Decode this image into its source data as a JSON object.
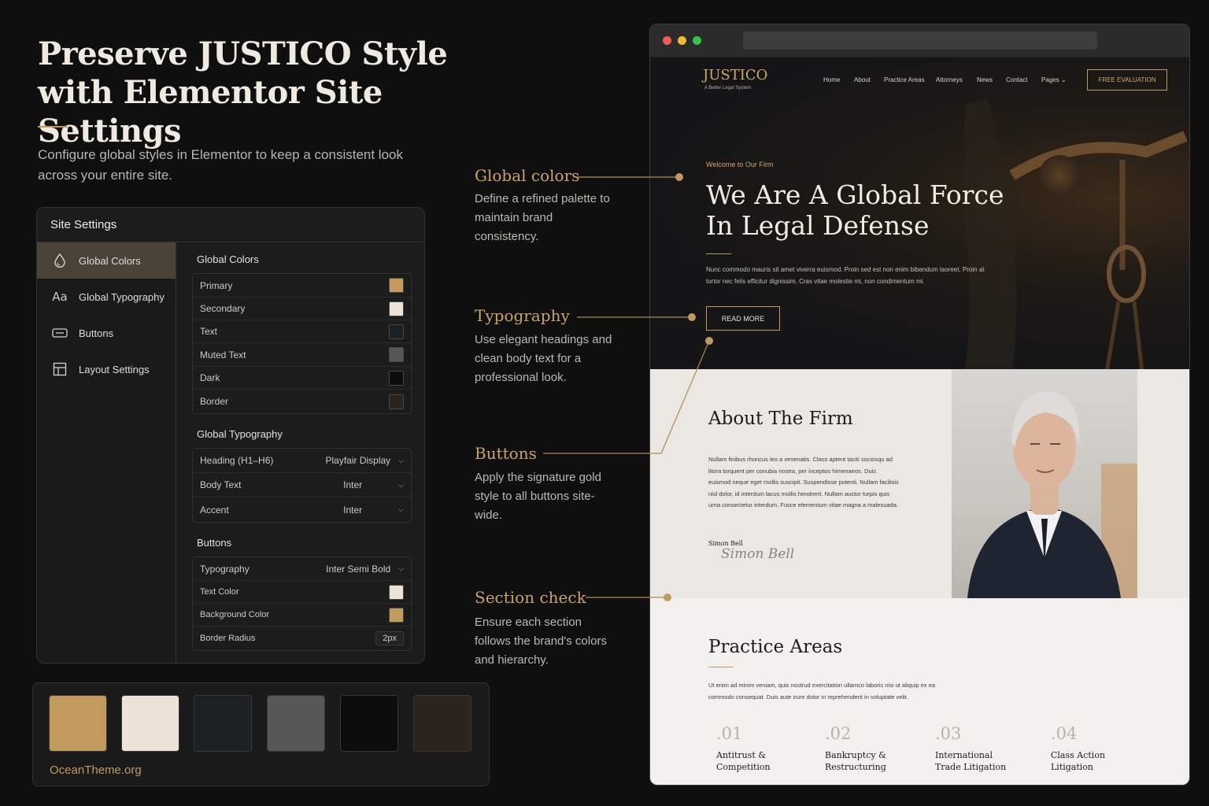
{
  "hero": {
    "title": "Preserve JUSTICO Style with Elementor Site Settings",
    "subtitle": "Configure global styles in Elementor to keep a consistent look across your entire site."
  },
  "settings": {
    "title": "Site Settings",
    "sidebar": [
      {
        "label": "Global Colors",
        "icon": "drop-icon",
        "active": true
      },
      {
        "label": "Global Typography",
        "icon": "typography-icon"
      },
      {
        "label": "Buttons",
        "icon": "button-icon"
      },
      {
        "label": "Layout Settings",
        "icon": "layout-icon"
      }
    ],
    "colors": {
      "title": "Global Colors",
      "items": [
        {
          "label": "Primary",
          "color": "#c29a5e"
        },
        {
          "label": "Secondary",
          "color": "#ede3d6"
        },
        {
          "label": "Text",
          "color": "#1b2025"
        },
        {
          "label": "Muted Text",
          "color": "#575757"
        },
        {
          "label": "Dark",
          "color": "#0c0c0c"
        },
        {
          "label": "Border",
          "color": "#2b231d"
        }
      ]
    },
    "typography": {
      "title": "Global Typography",
      "items": [
        {
          "label": "Heading (H1–H6)",
          "value": "Playfair Display"
        },
        {
          "label": "Body Text",
          "value": "Inter"
        },
        {
          "label": "Accent",
          "value": "Inter"
        }
      ]
    },
    "buttons": {
      "title": "Buttons",
      "typography_label": "Typography",
      "typography_value": "Inter Semi Bold",
      "text_color_label": "Text Color",
      "text_color": "#ede3d6",
      "bg_color_label": "Background Color",
      "bg_color": "#c29a5e",
      "radius_label": "Border Radius",
      "radius_value": "2px"
    }
  },
  "palette": {
    "colors": [
      "#c29a5e",
      "#ede3d6",
      "#1b2025",
      "#575757",
      "#0c0c0c",
      "#2b231d"
    ],
    "brand": "OceanTheme.org"
  },
  "annotations": [
    {
      "title": "Global colors",
      "text": "Define a refined palette to maintain brand consistency."
    },
    {
      "title": "Typography",
      "text": "Use elegant headings and clean body text for a professional look."
    },
    {
      "title": "Buttons",
      "text": "Apply the signature gold style to all buttons site-wide."
    },
    {
      "title": "Section check",
      "text": "Ensure each section follows the brand's colors and hierarchy."
    }
  ],
  "site": {
    "logo": "JUSTICO",
    "logo_tagline": "A Better Legal System",
    "nav": [
      "Home",
      "About",
      "Practice Areas",
      "Attorneys",
      "News",
      "Contact",
      "Pages"
    ],
    "cta": "FREE EVALUATION",
    "welcome": "Welcome to Our Firm",
    "hero_heading": "We Are A Global Force In Legal Defense",
    "hero_text": "Nunc commodo mauris sit amet viverra euismod. Proin sed est non enim bibendum laoreet. Proin at tortor nec felis efficitur dignissim. Cras vitae molestie mi, non condimentum mi.",
    "read_more": "READ MORE",
    "about_heading": "About The Firm",
    "about_text": "Nullam finibus rhoncus leo a venenatis. Class aptent taciti sociosqu ad litora torquent per conubia nostra, per inceptos himenaeos. Duis euismod neque eget mollis suscipit. Suspendisse potenti. Nullam facilisis nisl dolor, id interdum lacus mollis hendrerit. Nullam auctor turpis quis urna consectetur interdum. Fusce elementum vitae magna a malesuada.",
    "about_name": "Simon Bell",
    "about_signature": "Simon Bell",
    "practice_heading": "Practice Areas",
    "practice_text": "Ut enim ad minim veniam, quis nostrud exercitation ullamco laboris nisi ut aliquip ex ea commodo consequat. Duis aute irure dolor in reprehenderit in voluptate velit.",
    "practice_areas": [
      {
        "num": ".01",
        "name": "Antitrust & Competition"
      },
      {
        "num": ".02",
        "name": "Bankruptcy & Restructuring"
      },
      {
        "num": ".03",
        "name": "International Trade Litigation"
      },
      {
        "num": ".04",
        "name": "Class Action Litigation"
      }
    ]
  }
}
